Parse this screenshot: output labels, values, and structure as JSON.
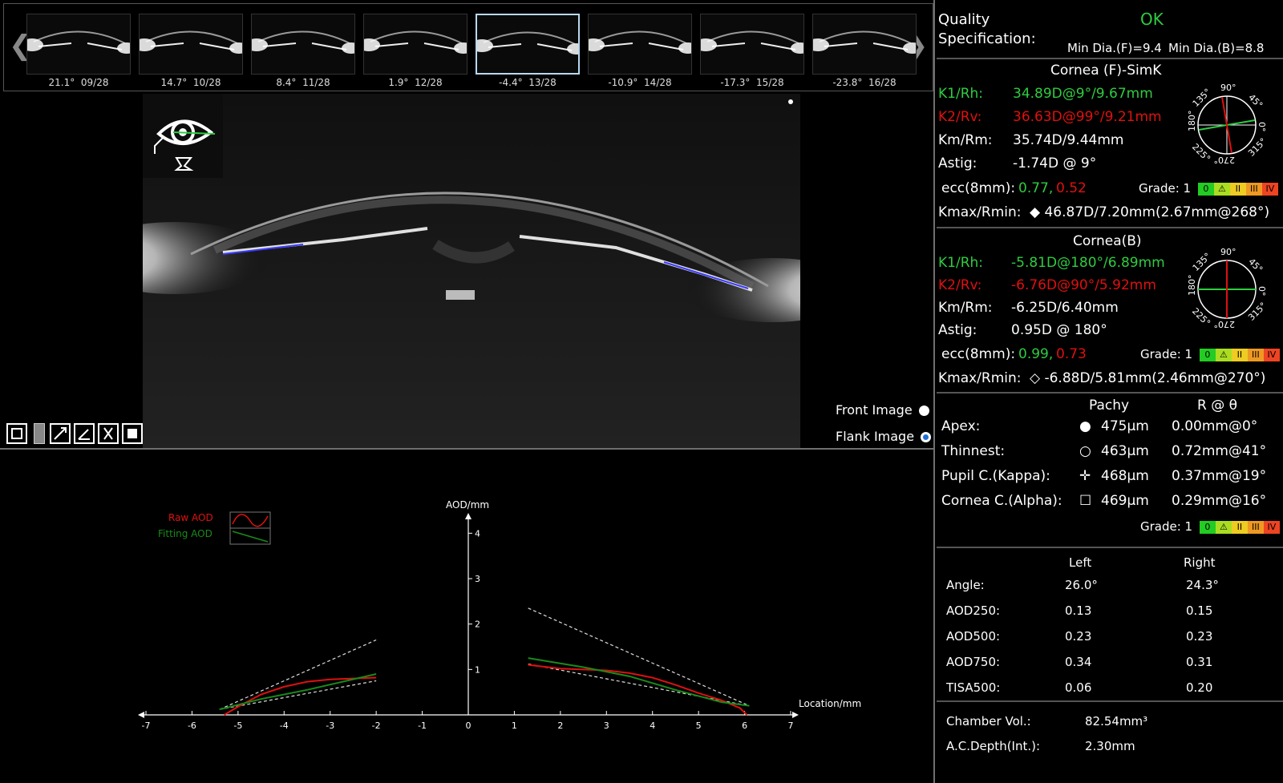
{
  "thumbnails": [
    {
      "angle": "21.1°",
      "frame": "09/28"
    },
    {
      "angle": "14.7°",
      "frame": "10/28"
    },
    {
      "angle": "8.4°",
      "frame": "11/28"
    },
    {
      "angle": "1.9°",
      "frame": "12/28"
    },
    {
      "angle": "-4.4°",
      "frame": "13/28",
      "selected": true
    },
    {
      "angle": "-10.9°",
      "frame": "14/28"
    },
    {
      "angle": "-17.3°",
      "frame": "15/28"
    },
    {
      "angle": "-23.8°",
      "frame": "16/28"
    }
  ],
  "nav": {
    "prev": "❮",
    "next": "❯"
  },
  "image_options": {
    "front": "Front Image",
    "flank": "Flank Image",
    "selected": "flank"
  },
  "quality": {
    "label1": "Quality",
    "label2": "Specification:",
    "status": "OK",
    "min_f": "Min Dia.(F)=9.4",
    "min_b": "Min Dia.(B)=8.8"
  },
  "cornea_front": {
    "title": "Cornea (F)-SimK",
    "k1_label": "K1/Rh:",
    "k1": "34.89D@9°/9.67mm",
    "k2_label": "K2/Rv:",
    "k2": "36.63D@99°/9.21mm",
    "km_label": "Km/Rm:",
    "km": "35.74D/9.44mm",
    "astig_label": "Astig:",
    "astig": "-1.74D @ 9°",
    "ecc_label": "ecc(8mm):",
    "ecc1": "0.77,",
    "ecc2": "0.52",
    "grade": "Grade: 1",
    "kmax_label": "Kmax/Rmin:",
    "kmax": "46.87D/7.20mm(2.67mm@268°)"
  },
  "cornea_back": {
    "title": "Cornea(B)",
    "k1_label": "K1/Rh:",
    "k1": "-5.81D@180°/6.89mm",
    "k2_label": "K2/Rv:",
    "k2": "-6.76D@90°/5.92mm",
    "km_label": "Km/Rm:",
    "km": "-6.25D/6.40mm",
    "astig_label": "Astig:",
    "astig": "0.95D @ 180°",
    "ecc_label": "ecc(8mm):",
    "ecc1": "0.99,",
    "ecc2": "0.73",
    "grade": "Grade: 1",
    "kmax_label": "Kmax/Rmin:",
    "kmax": "-6.88D/5.81mm(2.46mm@270°)"
  },
  "compass_labels": {
    "a90": "90°",
    "a45": "45°",
    "a0": "0°",
    "a315": "315°",
    "a270": "270°",
    "a225": "225°",
    "a180": "180°",
    "a135": "135°"
  },
  "grade_boxes": [
    "0",
    "⚠",
    "II",
    "III",
    "IV"
  ],
  "pachy": {
    "col1": "Pachy",
    "col2": "R @ θ",
    "rows": [
      {
        "label": "Apex:",
        "value": "475μm",
        "rtheta": "0.00mm@0°"
      },
      {
        "label": "Thinnest:",
        "value": "463μm",
        "rtheta": "0.72mm@41°"
      },
      {
        "label": "Pupil C.(Kappa):",
        "value": "468μm",
        "rtheta": "0.37mm@19°"
      },
      {
        "label": "Cornea C.(Alpha):",
        "value": "469μm",
        "rtheta": "0.29mm@16°"
      }
    ],
    "grade": "Grade: 1"
  },
  "angles": {
    "col_left": "Left",
    "col_right": "Right",
    "rows": [
      {
        "label": "Angle:",
        "left": "26.0°",
        "right": "24.3°"
      },
      {
        "label": "AOD250:",
        "left": "0.13",
        "right": "0.15"
      },
      {
        "label": "AOD500:",
        "left": "0.23",
        "right": "0.23"
      },
      {
        "label": "AOD750:",
        "left": "0.34",
        "right": "0.31"
      },
      {
        "label": "TISA500:",
        "left": "0.06",
        "right": "0.20"
      }
    ]
  },
  "chamber": {
    "vol_label": "Chamber Vol.:",
    "vol": "82.54mm³",
    "depth_label": "A.C.Depth(Int.):",
    "depth": "2.30mm"
  },
  "colors": {
    "green": "#2ecc40",
    "red": "#e01010",
    "accent_blue": "#1f6fd8"
  },
  "chart_data": {
    "type": "line",
    "ylabel": "AOD/mm",
    "xlabel": "Location/mm",
    "xlim": [
      -7,
      7
    ],
    "ylim": [
      0,
      4
    ],
    "xticks": [
      "-7",
      "-6",
      "-5",
      "-4",
      "-3",
      "-2",
      "-1",
      "0",
      "1",
      "2",
      "3",
      "4",
      "5",
      "6",
      "7"
    ],
    "yticks": [
      "1",
      "2",
      "3",
      "4"
    ],
    "legend": [
      "Raw AOD",
      "Fitting AOD"
    ],
    "series": [
      {
        "name": "Raw AOD",
        "color": "#e01010",
        "segments": [
          [
            [
              -5.3,
              0.0
            ],
            [
              -5.0,
              0.18
            ],
            [
              -4.5,
              0.45
            ],
            [
              -4.0,
              0.62
            ],
            [
              -3.5,
              0.73
            ],
            [
              -3.0,
              0.78
            ],
            [
              -2.5,
              0.8
            ],
            [
              -2.0,
              0.82
            ]
          ],
          [
            [
              1.3,
              1.1
            ],
            [
              2.0,
              1.02
            ],
            [
              3.0,
              0.98
            ],
            [
              3.5,
              0.92
            ],
            [
              4.0,
              0.82
            ],
            [
              4.5,
              0.66
            ],
            [
              5.0,
              0.48
            ],
            [
              5.5,
              0.32
            ],
            [
              5.9,
              0.15
            ],
            [
              6.05,
              0.0
            ]
          ]
        ]
      },
      {
        "name": "Fitting AOD",
        "color": "#1a8a1a",
        "segments": [
          [
            [
              -5.4,
              0.12
            ],
            [
              -4.5,
              0.35
            ],
            [
              -3.5,
              0.55
            ],
            [
              -2.0,
              0.9
            ]
          ],
          [
            [
              1.3,
              1.25
            ],
            [
              2.5,
              1.05
            ],
            [
              3.5,
              0.85
            ],
            [
              4.5,
              0.55
            ],
            [
              5.5,
              0.28
            ],
            [
              6.1,
              0.2
            ]
          ]
        ]
      }
    ],
    "reference_lines": [
      [
        [
          -5.4,
          0.12
        ],
        [
          -2.0,
          1.65
        ]
      ],
      [
        [
          1.3,
          2.35
        ],
        [
          6.1,
          0.2
        ]
      ],
      [
        [
          -5.4,
          0.12
        ],
        [
          -2.0,
          0.75
        ]
      ],
      [
        [
          1.3,
          1.12
        ],
        [
          6.1,
          0.2
        ]
      ]
    ]
  }
}
